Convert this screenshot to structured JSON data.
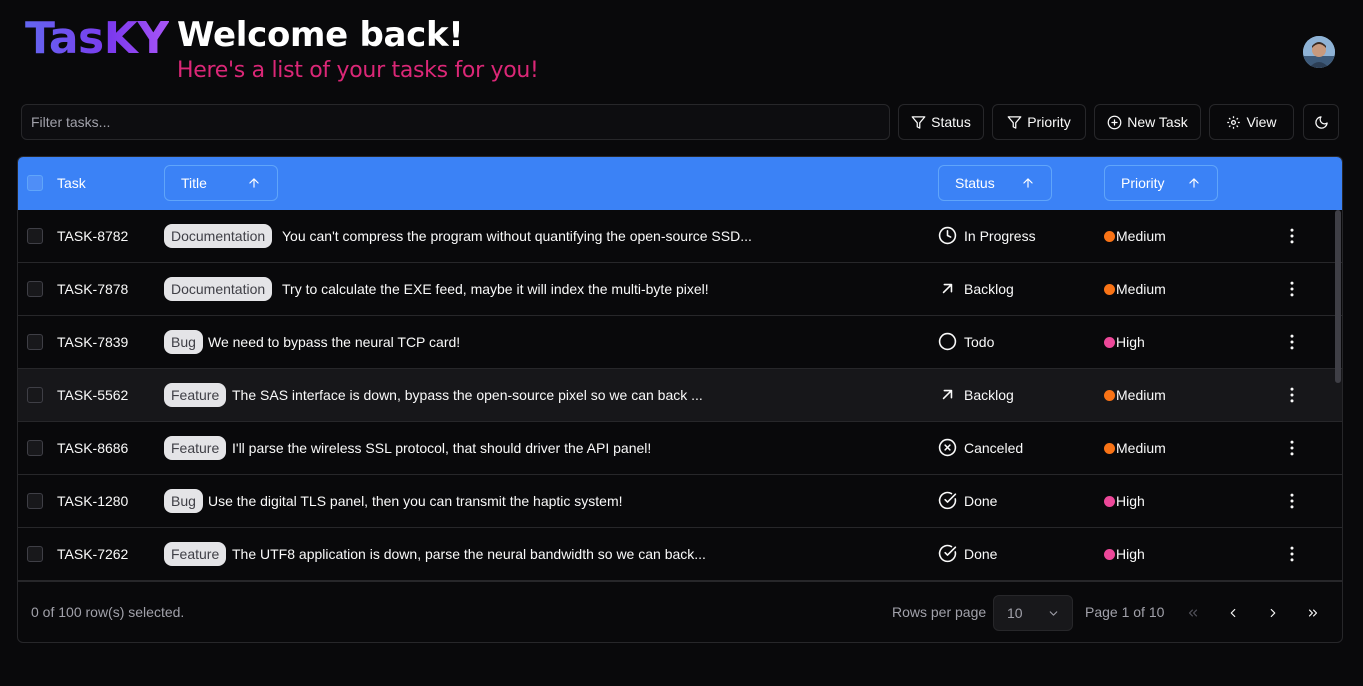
{
  "header": {
    "logo": "TasKY",
    "title": "Welcome back!",
    "subtitle": "Here's a list of your tasks for you!"
  },
  "toolbar": {
    "filter_placeholder": "Filter tasks...",
    "status_label": "Status",
    "priority_label": "Priority",
    "new_task_label": "New Task",
    "view_label": "View"
  },
  "table": {
    "columns": {
      "task": "Task",
      "title": "Title",
      "status": "Status",
      "priority": "Priority"
    },
    "rows": [
      {
        "id": "TASK-8782",
        "label": "Documentation",
        "title": "You can't compress the program without quantifying the open-source SSD...",
        "status": "In Progress",
        "status_icon": "clock-icon",
        "priority": "Medium",
        "priority_color": "#f97316"
      },
      {
        "id": "TASK-7878",
        "label": "Documentation",
        "title": "Try to calculate the EXE feed, maybe it will index the multi-byte pixel!",
        "status": "Backlog",
        "status_icon": "arrow-up-right-icon",
        "priority": "Medium",
        "priority_color": "#f97316"
      },
      {
        "id": "TASK-7839",
        "label": "Bug",
        "title": "We need to bypass the neural TCP card!",
        "status": "Todo",
        "status_icon": "circle-icon",
        "priority": "High",
        "priority_color": "#ec4899"
      },
      {
        "id": "TASK-5562",
        "label": "Feature",
        "title": "The SAS interface is down, bypass the open-source pixel so we can back ...",
        "status": "Backlog",
        "status_icon": "arrow-up-right-icon",
        "priority": "Medium",
        "priority_color": "#f97316"
      },
      {
        "id": "TASK-8686",
        "label": "Feature",
        "title": "I'll parse the wireless SSL protocol, that should driver the API panel!",
        "status": "Canceled",
        "status_icon": "x-circle-icon",
        "priority": "Medium",
        "priority_color": "#f97316"
      },
      {
        "id": "TASK-1280",
        "label": "Bug",
        "title": "Use the digital TLS panel, then you can transmit the haptic system!",
        "status": "Done",
        "status_icon": "check-circle-icon",
        "priority": "High",
        "priority_color": "#ec4899"
      },
      {
        "id": "TASK-7262",
        "label": "Feature",
        "title": "The UTF8 application is down, parse the neural bandwidth so we can back...",
        "status": "Done",
        "status_icon": "check-circle-icon",
        "priority": "High",
        "priority_color": "#ec4899"
      }
    ]
  },
  "footer": {
    "selection": "0 of 100 row(s) selected.",
    "rows_per_page_label": "Rows per page",
    "rows_per_page_value": "10",
    "page_info": "Page 1 of 10"
  },
  "colors": {
    "accent": "#3b82f6",
    "subtitle": "#db2777",
    "medium": "#f97316",
    "high": "#ec4899"
  }
}
